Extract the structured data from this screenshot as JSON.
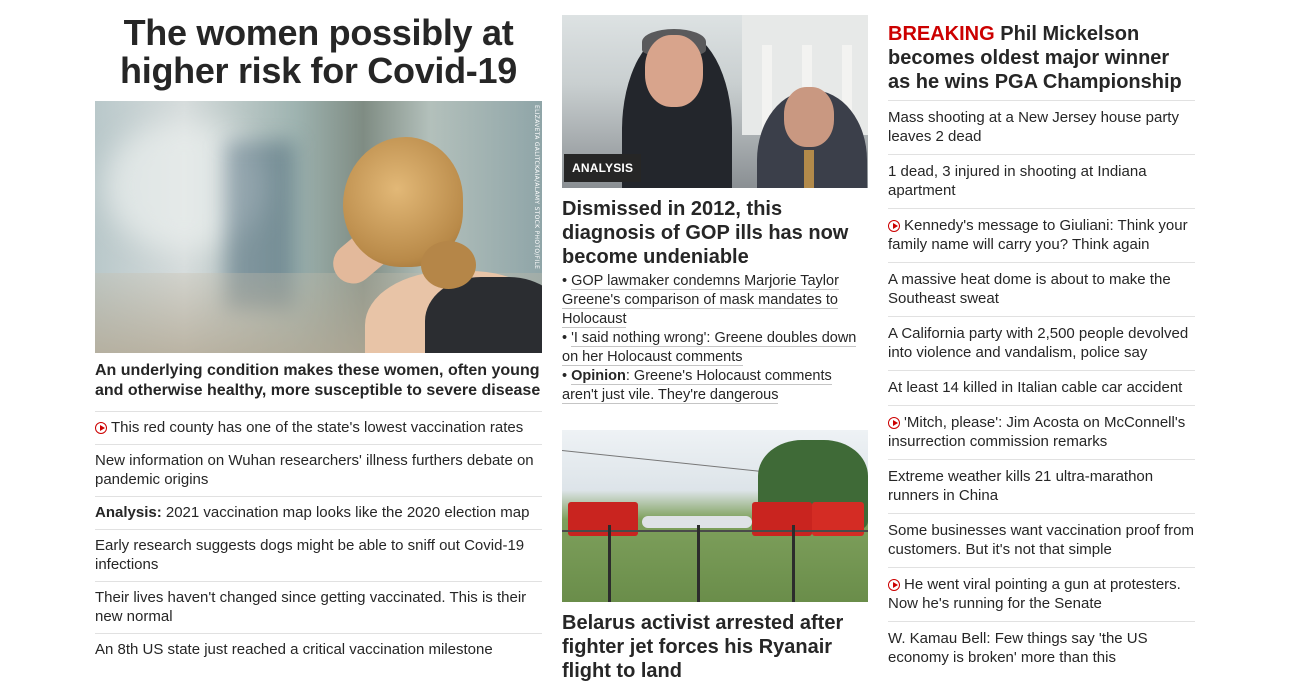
{
  "column1": {
    "headline": "The women possibly at higher risk for Covid-19",
    "image_credit": "ELIZAVETA GALITCKAIA/ALAMY STOCK PHOTO/FILE",
    "caption": "An underlying condition makes these women, often young and otherwise healthy, more susceptible to severe disease",
    "links": [
      {
        "text": "This red county has one of the state's lowest vaccination rates",
        "video": true
      },
      {
        "text": "New information on Wuhan researchers' illness furthers debate on pandemic origins"
      },
      {
        "prefix": "Analysis:",
        "text": " 2021 vaccination map looks like the 2020 election map"
      },
      {
        "text": "Early research suggests dogs might be able to sniff out Covid-19 infections"
      },
      {
        "text": "Their lives haven't changed since getting vaccinated. This is their new normal"
      },
      {
        "text": "An 8th US state just reached a critical vaccination milestone"
      }
    ]
  },
  "column2": {
    "tag": "ANALYSIS",
    "headline": "Dismissed in 2012, this diagnosis of GOP ills has now become undeniable",
    "bullets": [
      {
        "text": "GOP lawmaker condemns Marjorie Taylor Greene's comparison of mask mandates to Holocaust"
      },
      {
        "text": "'I said nothing wrong': Greene doubles down on her Holocaust comments"
      },
      {
        "prefix": "Opinion",
        "text": ": Greene's Holocaust comments aren't just vile. They're dangerous"
      }
    ],
    "bullet_mark": "•",
    "headline2": "Belarus activist arrested after fighter jet forces his Ryanair flight to land"
  },
  "column3": {
    "breaking_label": "BREAKING",
    "breaking_text": " Phil Mickelson becomes oldest major winner as he wins PGA Championship",
    "links": [
      {
        "text": "Mass shooting at a New Jersey house party leaves 2 dead"
      },
      {
        "text": "1 dead, 3 injured in shooting at Indiana apartment"
      },
      {
        "text": "Kennedy's message to Giuliani: Think your family name will carry you? Think again",
        "video": true
      },
      {
        "text": "A massive heat dome is about to make the Southeast sweat"
      },
      {
        "text": "A California party with 2,500 people devolved into violence and vandalism, police say"
      },
      {
        "text": "At least 14 killed in Italian cable car accident"
      },
      {
        "text": "'Mitch, please': Jim Acosta on McConnell's insurrection commission remarks",
        "video": true
      },
      {
        "text": "Extreme weather kills 21 ultra-marathon runners in China"
      },
      {
        "text": "Some businesses want vaccination proof from customers. But it's not that simple"
      },
      {
        "text": "He went viral pointing a gun at protesters. Now he's running for the Senate",
        "video": true
      },
      {
        "text": "W. Kamau Bell: Few things say 'the US economy is broken' more than this"
      }
    ]
  },
  "colors": {
    "text": "#262626",
    "accent_red": "#cc0000",
    "divider": "#e1e1e1"
  }
}
